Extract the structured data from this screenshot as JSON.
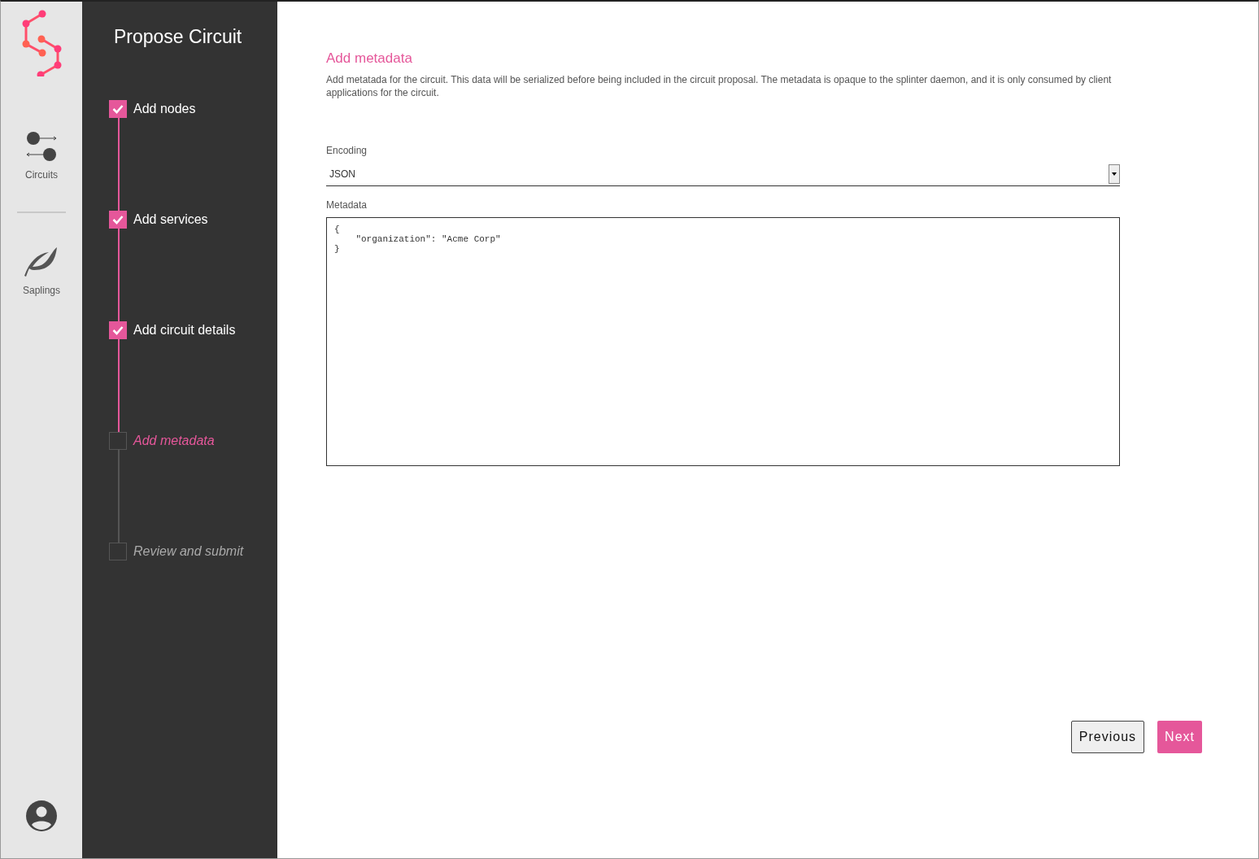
{
  "nav": {
    "items": [
      {
        "label": "Circuits",
        "kind": "circuits"
      },
      {
        "label": "Saplings",
        "kind": "saplings"
      }
    ]
  },
  "stepper": {
    "title": "Propose Circuit",
    "steps": [
      {
        "label": "Add nodes",
        "checked": true,
        "selected": false
      },
      {
        "label": "Add services",
        "checked": true,
        "selected": false
      },
      {
        "label": "Add circuit details",
        "checked": true,
        "selected": false
      },
      {
        "label": "Add metadata",
        "checked": false,
        "selected": true
      },
      {
        "label": "Review and submit",
        "checked": false,
        "selected": false
      }
    ]
  },
  "form": {
    "title": "Add metadata",
    "description": "Add metatada for the circuit. This data will be serialized before being included in the circuit proposal. The metadata is opaque to the splinter daemon, and it is only consumed by client applications for the circuit.",
    "encoding": {
      "label": "Encoding",
      "value": "JSON"
    },
    "metadata": {
      "label": "Metadata",
      "value": "{\n    \"organization\": \"Acme Corp\"\n}"
    }
  },
  "buttons": [
    {
      "label": "Previous",
      "kind": "secondary"
    },
    {
      "label": "Next",
      "kind": "primary"
    }
  ]
}
